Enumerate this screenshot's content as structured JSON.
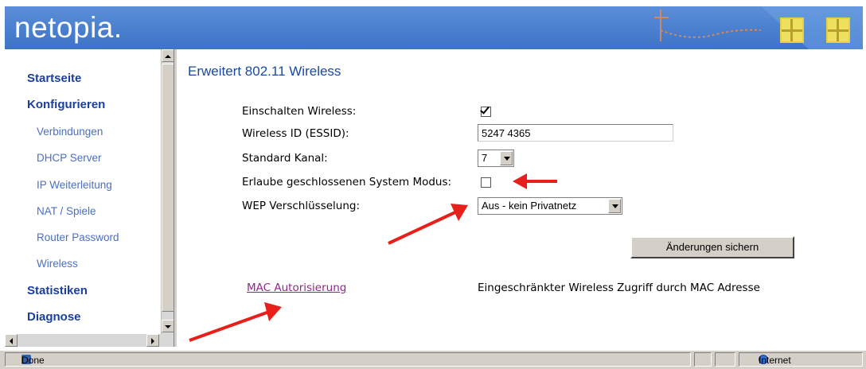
{
  "header": {
    "logo_text": "netopia."
  },
  "sidebar": {
    "items": [
      {
        "label": "Startseite"
      },
      {
        "label": "Konfigurieren"
      },
      {
        "label": "Verbindungen"
      },
      {
        "label": "DHCP Server"
      },
      {
        "label": "IP Weiterleitung"
      },
      {
        "label": "NAT / Spiele"
      },
      {
        "label": "Router Password"
      },
      {
        "label": "Wireless"
      },
      {
        "label": "Statistiken"
      },
      {
        "label": "Diagnose"
      }
    ]
  },
  "main": {
    "title": "Erweitert 802.11 Wireless",
    "fields": {
      "enable_label": "Einschalten Wireless:",
      "enable_checked": true,
      "essid_label": "Wireless ID (ESSID):",
      "essid_value": "5247 4365",
      "channel_label": "Standard Kanal:",
      "channel_value": "7",
      "closed_label": "Erlaube geschlossenen System Modus:",
      "closed_checked": false,
      "wep_label": "WEP Verschlüsselung:",
      "wep_value": "Aus - kein Privatnetz"
    },
    "save_button": "Änderungen sichern",
    "mac_link": "MAC Autorisierung",
    "mac_description": "Eingeschränkter Wireless Zugriff durch MAC Adresse"
  },
  "statusbar": {
    "status_text": "Done",
    "zone_text": "Internet"
  },
  "colors": {
    "header": "#4a7fcf",
    "nav_main": "#1a3f9f",
    "nav_sub": "#4a6fc4",
    "arrow": "#e8201c"
  }
}
